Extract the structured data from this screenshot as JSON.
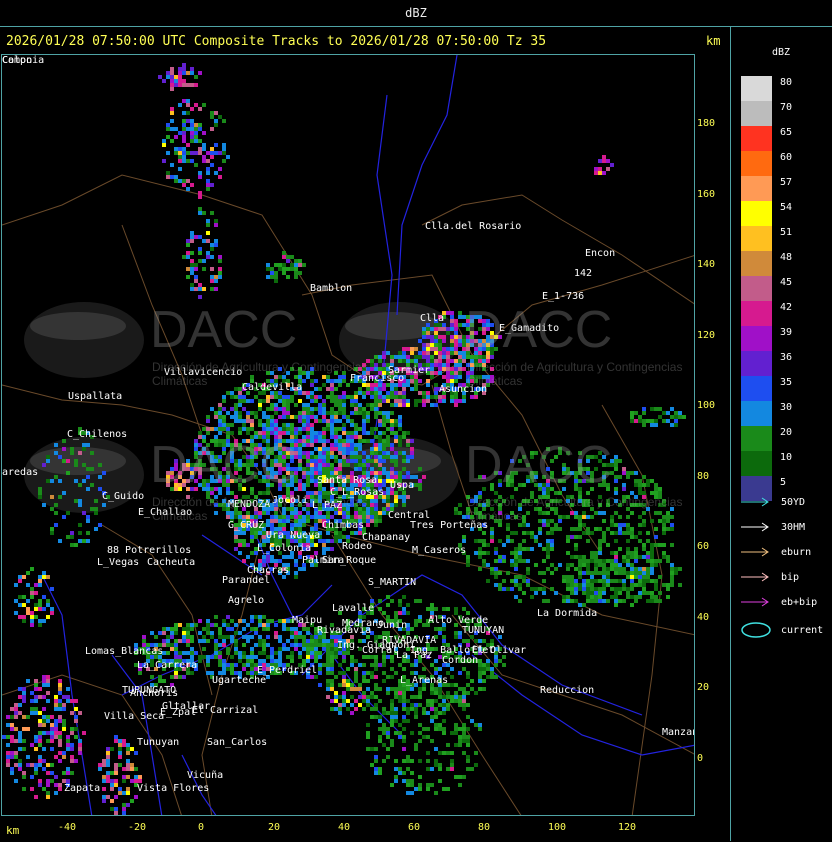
{
  "header": {
    "title": "dBZ"
  },
  "status": {
    "text": "2026/01/28 07:50:00 UTC Composite Tracks to 2026/01/28 07:50:00 Tz 35",
    "unit": "km"
  },
  "legend": {
    "title": "dBZ",
    "scale": [
      {
        "label": "80",
        "color": "#d9d9d9"
      },
      {
        "label": "70",
        "color": "#bcbcbc"
      },
      {
        "label": "65",
        "color": "#ff3320"
      },
      {
        "label": "60",
        "color": "#ff6a10"
      },
      {
        "label": "57",
        "color": "#ff9a55"
      },
      {
        "label": "54",
        "color": "#ffff00"
      },
      {
        "label": "51",
        "color": "#ffc020"
      },
      {
        "label": "48",
        "color": "#d08a3a"
      },
      {
        "label": "45",
        "color": "#c25c8a"
      },
      {
        "label": "42",
        "color": "#d61a8f"
      },
      {
        "label": "39",
        "color": "#a010c8"
      },
      {
        "label": "36",
        "color": "#6220d0"
      },
      {
        "label": "35",
        "color": "#1e4ef0"
      },
      {
        "label": "30",
        "color": "#1388e0"
      },
      {
        "label": "20",
        "color": "#1a8a1a"
      },
      {
        "label": "10",
        "color": "#0c6a0c"
      },
      {
        "label": "5",
        "color": "#3a3a90"
      }
    ],
    "tracks": [
      {
        "label": "50YD",
        "color": "#40e0e0"
      },
      {
        "label": "30HM",
        "color": "#ffffff"
      },
      {
        "label": "eburn",
        "color": "#f0c080"
      },
      {
        "label": "bip",
        "color": "#ffc0c0"
      },
      {
        "label": "eb+bip",
        "color": "#e040e0"
      }
    ],
    "current_label": "current",
    "current_color": "#40e0e0"
  },
  "axes": {
    "x_unit": "km",
    "x_ticks": [
      "-40",
      "-20",
      "0",
      "20",
      "40",
      "60",
      "80",
      "100",
      "120"
    ],
    "y_ticks": [
      "180",
      "160",
      "140",
      "120",
      "100",
      "80",
      "60",
      "40",
      "20",
      "0"
    ]
  },
  "watermark": {
    "text": "DACC",
    "subtitle": "Dirección de Agricultura y Contingencias Climáticas"
  },
  "places": [
    "Clla.del Rosario",
    "Encon",
    "142",
    "E_1-736",
    "Bamblon",
    "Clla",
    "E_Gamadito",
    "Villavicencio",
    "Uspallata",
    "Caldevilla",
    "Francisco",
    "Sarmier",
    "Asuncion",
    "C_Chilenos",
    "aredas",
    "C_Guido",
    "E_Challao",
    "MENDOZA",
    "G_CRUZ",
    "Ura Nueva",
    "88 Potrerillos",
    "L_Vegas",
    "Cacheuta",
    "Parandel",
    "Chacras",
    "Agrelo",
    "Maipu",
    "S_MARTIN",
    "Chapanay",
    "Palmira",
    "M_Caseros",
    "L_Colonia",
    "San_Roque",
    "Rodeo",
    "Chimbas",
    "Uspa",
    "Central",
    "Tres Porteñas",
    "Santa Rosa",
    "Jocoli",
    "Lavalle",
    "Junin",
    "Rivadavia",
    "Medrano",
    "RIVADAVIA",
    "Alto Verde",
    "Ing. Giagnoni",
    "La Paz",
    "L_Arenas",
    "Reduccion",
    "La Dormida",
    "Lomas_Blancas",
    "La_Carrera",
    "Ugarteche",
    "Anchoris",
    "TUPUNGATO",
    "E_Perdriel",
    "El Carrizal",
    "Tunuyan",
    "Villa Seca",
    "Gltallar",
    "E_Zpal",
    "San_Carlos",
    "Zapata",
    "Vista Flores",
    "Manzano",
    "C_L_Rosas",
    "L_PAZ",
    "Corral",
    "Vicuña",
    "Ing. Balloffet",
    "TUNUYAN",
    "El Olivar",
    "Cordon",
    "Campo",
    "Colonia"
  ]
}
